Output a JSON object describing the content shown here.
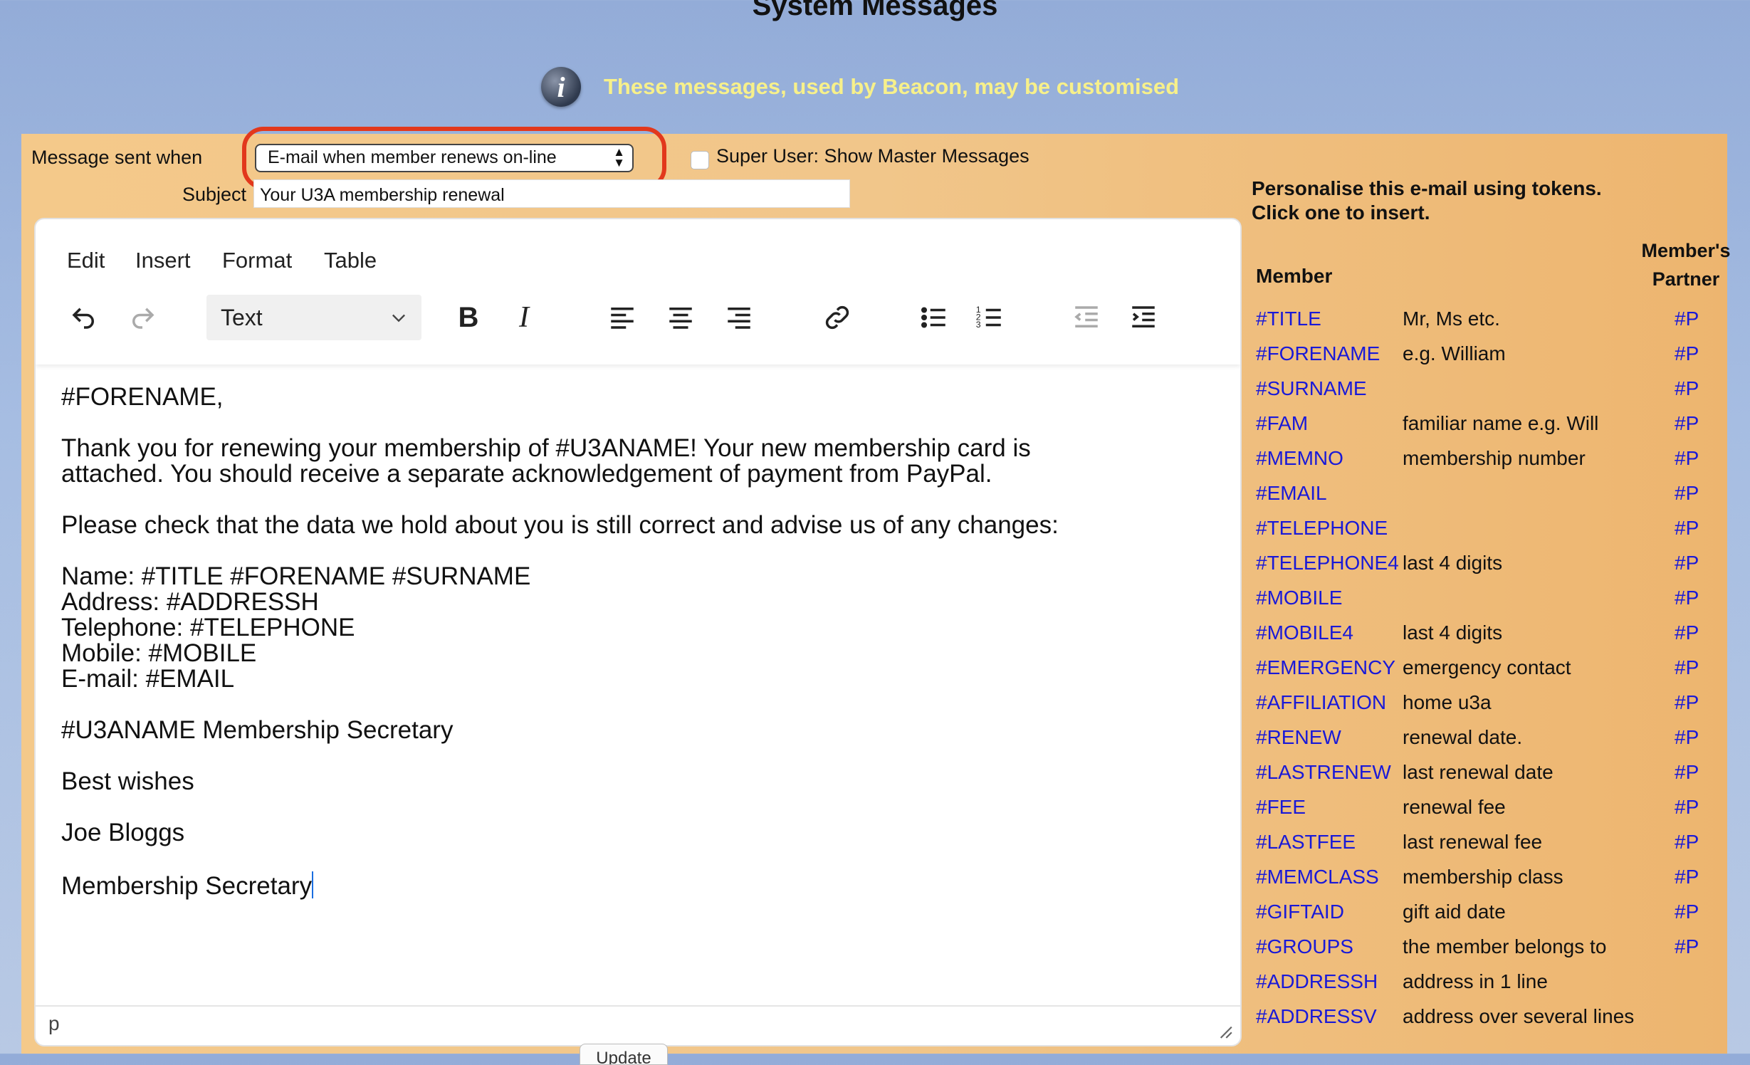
{
  "page": {
    "title": "System Messages",
    "info_text": "These messages, used by Beacon, may be customised"
  },
  "form": {
    "message_sent_label": "Message sent when",
    "message_select_value": "E-mail when member renews on-line",
    "super_user_label": "Super User: Show Master Messages",
    "super_user_checked": false,
    "subject_label": "Subject",
    "subject_value": "Your U3A membership renewal",
    "update_button": "Update"
  },
  "editor": {
    "menu": [
      "Edit",
      "Insert",
      "Format",
      "Table"
    ],
    "block_format": "Text",
    "toolbar_icons": [
      "undo-icon",
      "redo-icon",
      "bold-icon",
      "italic-icon",
      "align-left-icon",
      "align-center-icon",
      "align-right-icon",
      "link-icon",
      "bullet-list-icon",
      "numbered-list-icon",
      "outdent-icon",
      "indent-icon"
    ],
    "paragraphs": [
      [
        "#FORENAME,"
      ],
      [
        "Thank you for renewing your membership of #U3ANAME! Your new membership card is",
        "attached. You should receive a separate acknowledgement of payment from PayPal."
      ],
      [
        "Please check that the data we hold about you is still correct and advise us of any changes:"
      ],
      [
        "Name: #TITLE #FORENAME #SURNAME",
        "Address: #ADDRESSH",
        "Telephone: #TELEPHONE",
        "Mobile: #MOBILE",
        "E-mail: #EMAIL"
      ],
      [
        "#U3ANAME Membership Secretary"
      ],
      [
        "Best wishes"
      ],
      [
        "Joe Bloggs"
      ],
      [
        "Membership Secretary"
      ]
    ],
    "status_path": "p"
  },
  "tokens": {
    "intro_line1": "Personalise this e-mail using tokens.",
    "intro_line2": "Click one to insert.",
    "col_member": "Member",
    "col_partner_line1": "Member's",
    "col_partner_line2": "Partner",
    "rows": [
      {
        "token": "#TITLE",
        "desc": "Mr, Ms etc.",
        "partner": "#P"
      },
      {
        "token": "#FORENAME",
        "desc": "e.g. William",
        "partner": "#P"
      },
      {
        "token": "#SURNAME",
        "desc": "",
        "partner": "#P"
      },
      {
        "token": "#FAM",
        "desc": "familiar name e.g. Will",
        "partner": "#P"
      },
      {
        "token": "#MEMNO",
        "desc": "membership number",
        "partner": "#P"
      },
      {
        "token": "#EMAIL",
        "desc": "",
        "partner": "#P"
      },
      {
        "token": "#TELEPHONE",
        "desc": "",
        "partner": "#P"
      },
      {
        "token": "#TELEPHONE4",
        "desc": "last 4 digits",
        "partner": "#P"
      },
      {
        "token": "#MOBILE",
        "desc": "",
        "partner": "#P"
      },
      {
        "token": "#MOBILE4",
        "desc": "last 4 digits",
        "partner": "#P"
      },
      {
        "token": "#EMERGENCY",
        "desc": "emergency contact",
        "partner": "#P"
      },
      {
        "token": "#AFFILIATION",
        "desc": "home u3a",
        "partner": "#P"
      },
      {
        "token": "#RENEW",
        "desc": "renewal date.",
        "partner": "#P"
      },
      {
        "token": "#LASTRENEW",
        "desc": "last renewal date",
        "partner": "#P"
      },
      {
        "token": "#FEE",
        "desc": "renewal fee",
        "partner": "#P"
      },
      {
        "token": "#LASTFEE",
        "desc": "last renewal fee",
        "partner": "#P"
      },
      {
        "token": "#MEMCLASS",
        "desc": "membership class",
        "partner": "#P"
      },
      {
        "token": "#GIFTAID",
        "desc": "gift aid date",
        "partner": "#P"
      },
      {
        "token": "#GROUPS",
        "desc": "the member belongs to",
        "partner": "#P"
      },
      {
        "token": "#ADDRESSH",
        "desc": "address in 1 line",
        "partner": ""
      },
      {
        "token": "#ADDRESSV",
        "desc": "address over several lines",
        "partner": ""
      }
    ]
  },
  "colors": {
    "highlight_ring": "#e2381c",
    "token_link": "#1919d8",
    "info_text": "#f7f08a",
    "panel": "#f1c68a"
  }
}
